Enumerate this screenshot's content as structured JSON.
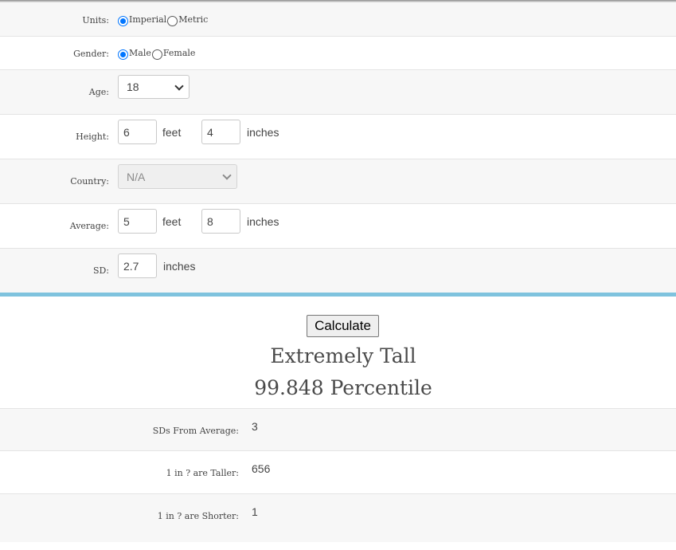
{
  "form": {
    "units": {
      "label": "Units:",
      "options": [
        "Imperial",
        "Metric"
      ],
      "selected": "Imperial"
    },
    "gender": {
      "label": "Gender:",
      "options": [
        "Male",
        "Female"
      ],
      "selected": "Male"
    },
    "age": {
      "label": "Age:",
      "value": "18"
    },
    "height": {
      "label": "Height:",
      "feet": "6",
      "feet_unit": "feet",
      "inches": "4",
      "inches_unit": "inches"
    },
    "country": {
      "label": "Country:",
      "value": "N/A"
    },
    "average": {
      "label": "Average:",
      "feet": "5",
      "feet_unit": "feet",
      "inches": "8",
      "inches_unit": "inches"
    },
    "sd": {
      "label": "SD:",
      "value": "2.7",
      "unit": "inches"
    }
  },
  "calculate_label": "Calculate",
  "result": {
    "category": "Extremely Tall",
    "percentile": "99.848 Percentile"
  },
  "outputs": [
    {
      "label": "SDs From Average:",
      "value": "3"
    },
    {
      "label": "1 in ? are Taller:",
      "value": "656"
    },
    {
      "label": "1 in ? are Shorter:",
      "value": "1"
    }
  ],
  "colors": {
    "accent_divider": "#7fc3de",
    "radio_checked": "#0075ff"
  }
}
